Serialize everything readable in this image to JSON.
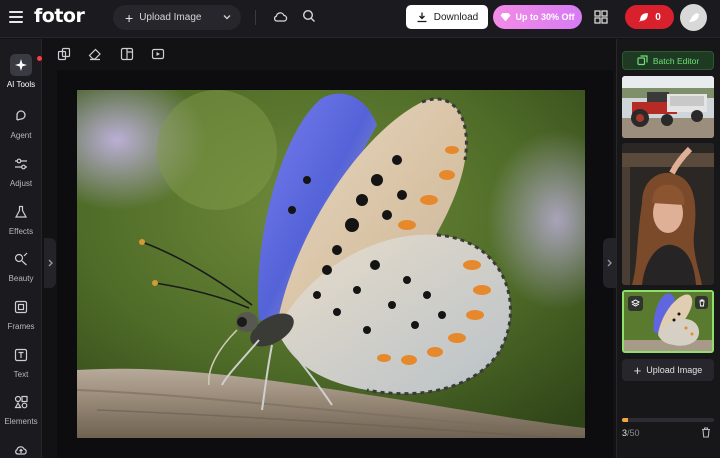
{
  "app": {
    "logo": "fotor"
  },
  "topbar": {
    "upload_label": "Upload Image",
    "download_label": "Download",
    "promo_label": "Up to 30% Off",
    "credits": "0"
  },
  "sidebar": {
    "items": [
      {
        "label": "AI Tools",
        "icon": "sparkle-icon"
      },
      {
        "label": "Agent",
        "icon": "agent-icon"
      },
      {
        "label": "Adjust",
        "icon": "sliders-icon"
      },
      {
        "label": "Effects",
        "icon": "flask-icon"
      },
      {
        "label": "Beauty",
        "icon": "beauty-icon"
      },
      {
        "label": "Frames",
        "icon": "frame-icon"
      },
      {
        "label": "Text",
        "icon": "text-icon"
      },
      {
        "label": "Elements",
        "icon": "elements-icon"
      }
    ]
  },
  "right_panel": {
    "batch_label": "Batch Editor",
    "upload_label": "Upload Image",
    "count_current": "3",
    "count_total": "/50",
    "progress": 0.06
  },
  "colors": {
    "accent_green": "#6fe07a",
    "promo_pink": "#f38be6",
    "credits_red": "#d9212e",
    "progress_orange": "#f3a73a"
  }
}
